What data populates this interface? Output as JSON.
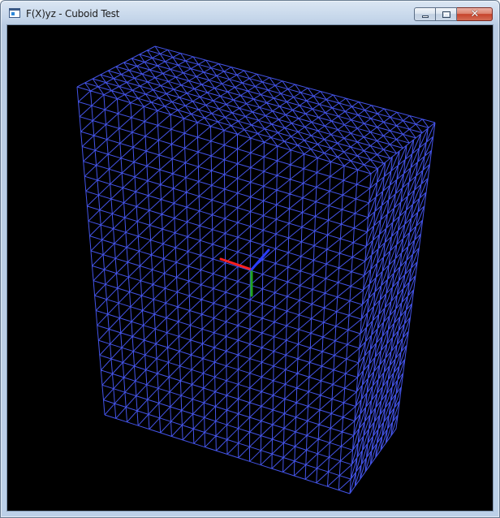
{
  "window": {
    "title": "F(X)yz - Cuboid Test",
    "icon": "application-icon",
    "controls": {
      "minimize_icon": "minimize-icon",
      "maximize_icon": "maximize-icon",
      "close_icon": "close-icon",
      "close_glyph": "x"
    }
  },
  "scene": {
    "background_color": "#000000",
    "mesh": {
      "shape": "cuboid",
      "render_mode": "wireframe triangle mesh",
      "color": "#4a5cff"
    },
    "axes": {
      "x_color": "#ff2020",
      "y_color": "#1fa51f",
      "z_color": "#2a3cff"
    }
  }
}
